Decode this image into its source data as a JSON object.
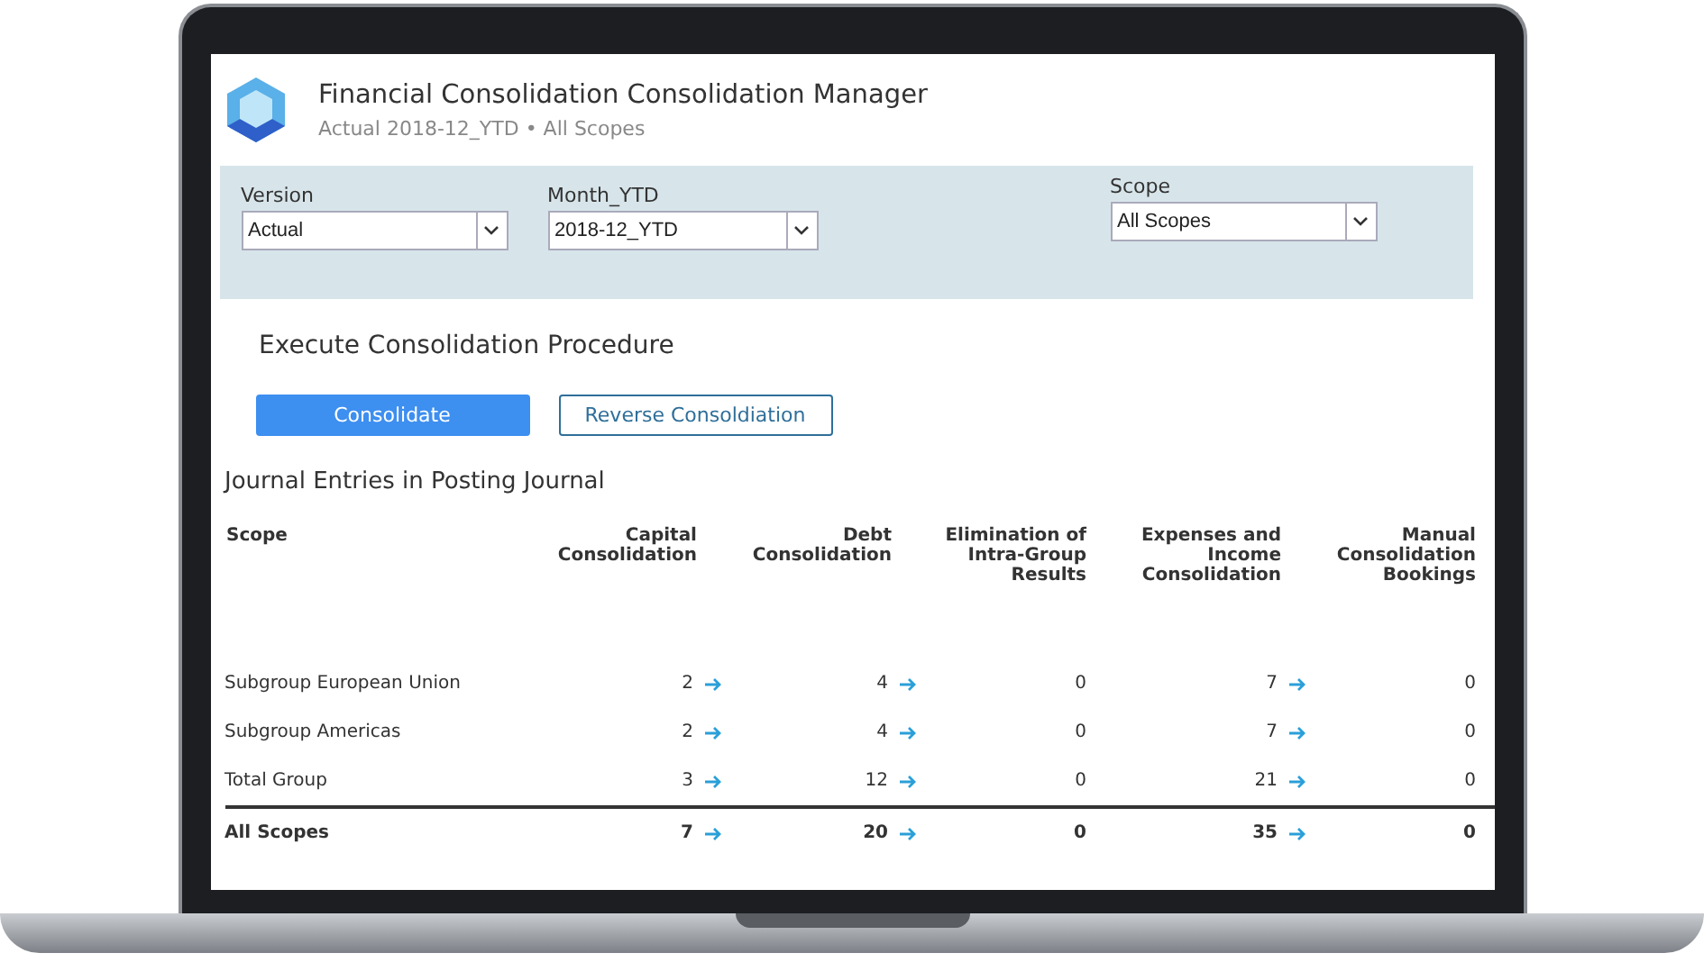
{
  "app": {
    "title": "Financial Consolidation Consolidation Manager",
    "subtitle": "Actual 2018-12_YTD • All Scopes"
  },
  "filters": [
    {
      "label": "Version",
      "value": "Actual"
    },
    {
      "label": "Month_YTD",
      "value": "2018-12_YTD"
    },
    {
      "label": "Scope",
      "value": "All Scopes"
    }
  ],
  "procedure": {
    "title": "Execute Consolidation Procedure",
    "buttons": [
      {
        "label": "Consolidate",
        "kind": "primary"
      },
      {
        "label": "Reverse Consoldiation",
        "kind": "secondary"
      }
    ]
  },
  "journal": {
    "title": "Journal Entries in Posting Journal",
    "columns": [
      "Scope",
      "Capital Consolidation",
      "Debt Consolidation",
      "Elimination of Intra-Group Results",
      "Expenses and Income Consolidation",
      "Manual Consolidation Bookings"
    ],
    "rows": [
      {
        "total": false,
        "cells": [
          {
            "value": "Subgroup European Union",
            "link": false
          },
          {
            "value": "2",
            "link": true
          },
          {
            "value": "4",
            "link": true
          },
          {
            "value": "0",
            "link": false
          },
          {
            "value": "7",
            "link": true
          },
          {
            "value": "0",
            "link": false
          }
        ]
      },
      {
        "total": false,
        "cells": [
          {
            "value": "Subgroup Americas",
            "link": false
          },
          {
            "value": "2",
            "link": true
          },
          {
            "value": "4",
            "link": true
          },
          {
            "value": "0",
            "link": false
          },
          {
            "value": "7",
            "link": true
          },
          {
            "value": "0",
            "link": false
          }
        ]
      },
      {
        "total": false,
        "cells": [
          {
            "value": "Total Group",
            "link": false
          },
          {
            "value": "3",
            "link": true
          },
          {
            "value": "12",
            "link": true
          },
          {
            "value": "0",
            "link": false
          },
          {
            "value": "21",
            "link": true
          },
          {
            "value": "0",
            "link": false
          }
        ]
      },
      {
        "total": true,
        "cells": [
          {
            "value": "All Scopes",
            "link": false
          },
          {
            "value": "7",
            "link": true
          },
          {
            "value": "20",
            "link": true
          },
          {
            "value": "0",
            "link": false
          },
          {
            "value": "35",
            "link": true
          },
          {
            "value": "0",
            "link": false
          }
        ]
      }
    ]
  }
}
